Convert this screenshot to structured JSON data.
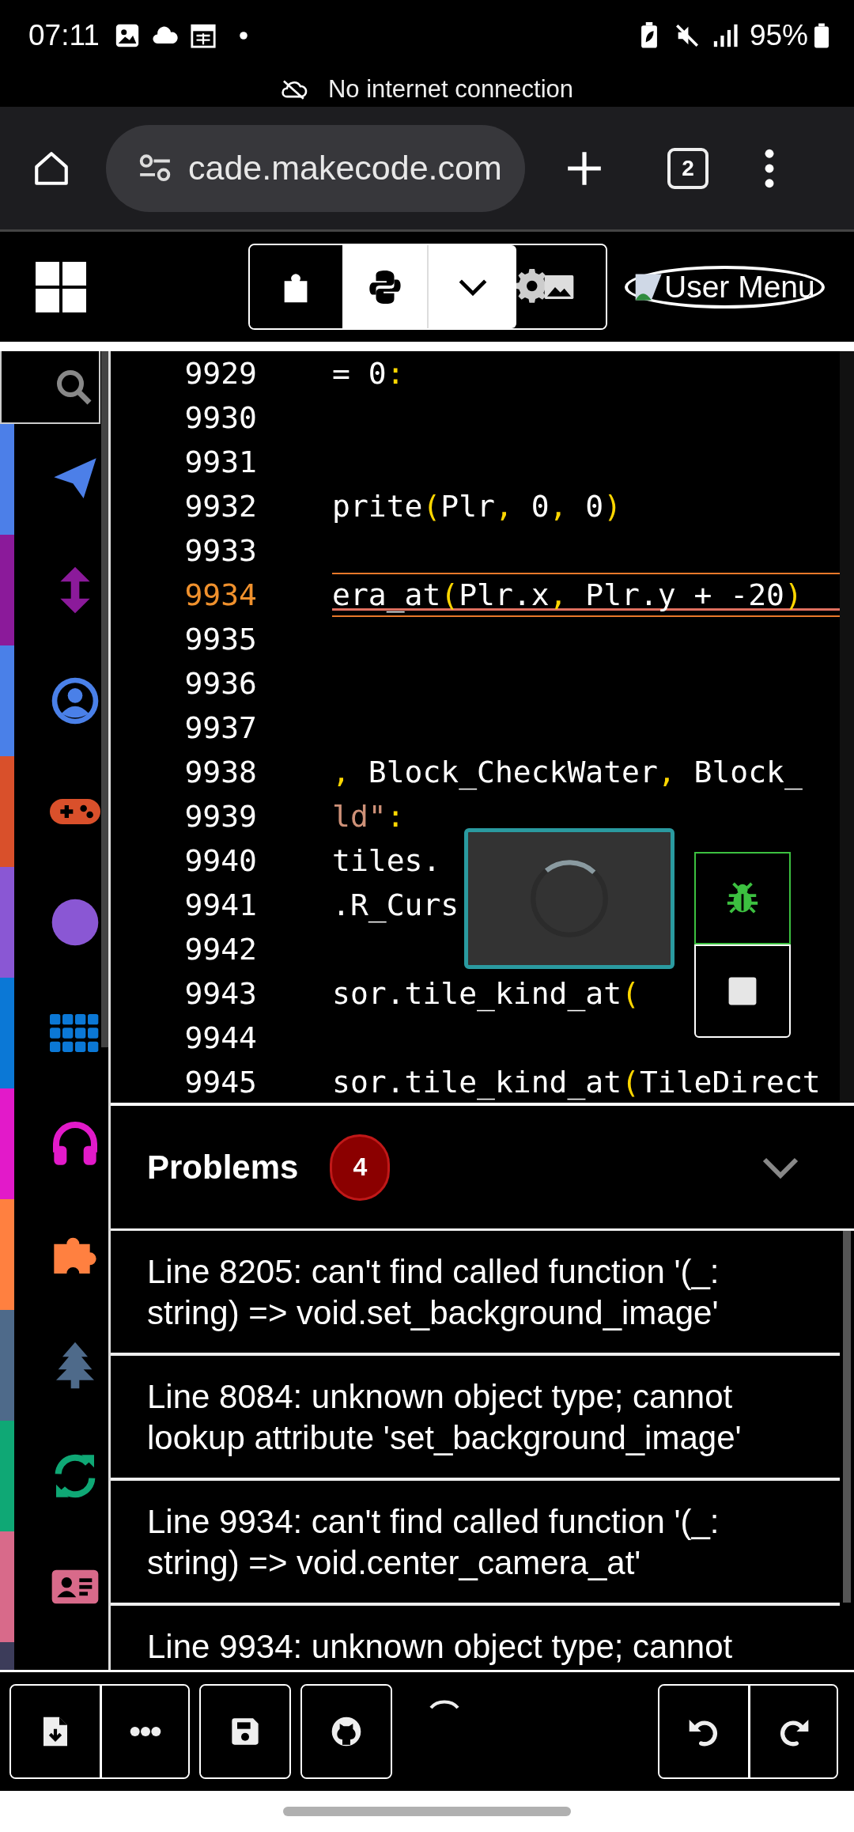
{
  "status_bar": {
    "time": "07:11",
    "battery": "95%"
  },
  "notice": "No internet connection",
  "browser": {
    "url": "cade.makecode.com",
    "tab_count": "2"
  },
  "app_header": {
    "editor_tabs": [
      {
        "kind": "blocks",
        "selected": false
      },
      {
        "kind": "python",
        "selected": true
      }
    ],
    "user_menu": "User Menu"
  },
  "sidebar": {
    "categories": [
      {
        "color": "#4c7fe8"
      },
      {
        "color": "#8b1a9a"
      },
      {
        "color": "#4a80e8"
      },
      {
        "color": "#d9502b"
      },
      {
        "color": "#8a57d4"
      },
      {
        "color": "#0b78d6"
      },
      {
        "color": "#e21ac9"
      },
      {
        "color": "#ff8040"
      },
      {
        "color": "#4e6a8a"
      },
      {
        "color": "#0fa875"
      },
      {
        "color": "#d86a8a"
      },
      {
        "color": "#3c3c5a"
      }
    ]
  },
  "editor": {
    "lines": [
      {
        "number": "9929",
        "current": false,
        "tokens": [
          {
            "text": "= 0",
            "kind": "plain"
          },
          {
            "text": ":",
            "kind": "punct"
          }
        ]
      },
      {
        "number": "9930",
        "current": false
      },
      {
        "number": "9931",
        "current": false
      },
      {
        "number": "9932",
        "current": false,
        "tokens": [
          {
            "text": "prite",
            "kind": "plain"
          },
          {
            "text": "(",
            "kind": "punct"
          },
          {
            "text": "Plr",
            "kind": "plain"
          },
          {
            "text": ",",
            "kind": "punct"
          },
          {
            "text": " 0",
            "kind": "plain"
          },
          {
            "text": ",",
            "kind": "punct"
          },
          {
            "text": " 0",
            "kind": "plain"
          },
          {
            "text": ")",
            "kind": "punct"
          }
        ]
      },
      {
        "number": "9933",
        "current": false
      },
      {
        "number": "9934",
        "current": true,
        "tokens": [
          {
            "text": "era_at",
            "kind": "plain"
          },
          {
            "text": "(",
            "kind": "punct"
          },
          {
            "text": "Plr.x",
            "kind": "plain"
          },
          {
            "text": ",",
            "kind": "punct"
          },
          {
            "text": " Plr.y + -20",
            "kind": "plain"
          },
          {
            "text": ")",
            "kind": "punct"
          }
        ]
      },
      {
        "number": "9935",
        "current": false
      },
      {
        "number": "9936",
        "current": false
      },
      {
        "number": "9937",
        "current": false
      },
      {
        "number": "9938",
        "current": false,
        "tokens": [
          {
            "text": ",",
            "kind": "punct"
          },
          {
            "text": " Block_CheckWater",
            "kind": "plain"
          },
          {
            "text": ",",
            "kind": "punct"
          },
          {
            "text": " Block_",
            "kind": "plain"
          }
        ]
      },
      {
        "number": "9939",
        "current": false,
        "tokens": [
          {
            "text": "ld\"",
            "kind": "string"
          },
          {
            "text": ":",
            "kind": "punct"
          }
        ]
      },
      {
        "number": "9940",
        "current": false,
        "tokens": [
          {
            "text": "tiles.",
            "kind": "plain"
          }
        ]
      },
      {
        "number": "9941",
        "current": false,
        "tokens": [
          {
            "text": ".R_Curs",
            "kind": "plain"
          }
        ]
      },
      {
        "number": "9942",
        "current": false
      },
      {
        "number": "9943",
        "current": false,
        "tokens": [
          {
            "text": "sor.tile_kind_at",
            "kind": "plain"
          },
          {
            "text": "(",
            "kind": "punct"
          }
        ]
      },
      {
        "number": "9944",
        "current": false
      },
      {
        "number": "9945",
        "current": false,
        "tokens": [
          {
            "text": "sor.tile_kind_at",
            "kind": "plain"
          },
          {
            "text": "(",
            "kind": "punct"
          },
          {
            "text": "TileDirect",
            "kind": "plain"
          }
        ]
      }
    ]
  },
  "problems": {
    "title": "Problems",
    "count": "4",
    "items": [
      "Line 8205: can't find called function '(_: string) => void.set_background_image'",
      "Line 8084: unknown object type; cannot lookup attribute 'set_background_image'",
      "Line 9934: can't find called function '(_: string) => void.center_camera_at'",
      "Line 9934: unknown object type; cannot"
    ]
  }
}
